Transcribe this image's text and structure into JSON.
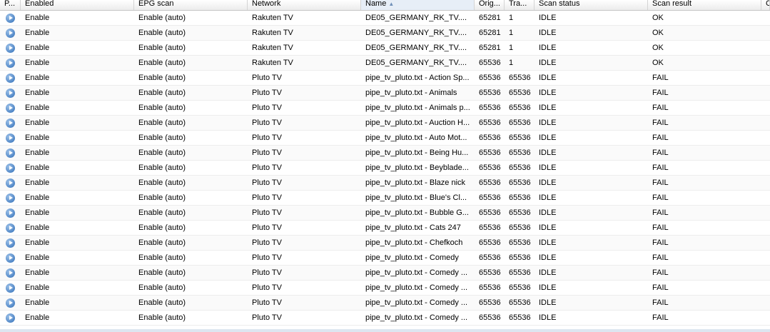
{
  "columns": [
    {
      "key": "play",
      "label": "P...",
      "width": 29
    },
    {
      "key": "enabled",
      "label": "Enabled",
      "width": 159
    },
    {
      "key": "epg",
      "label": "EPG scan",
      "width": 159
    },
    {
      "key": "network",
      "label": "Network",
      "width": 159
    },
    {
      "key": "name",
      "label": "Name",
      "width": 159,
      "sorted": "asc"
    },
    {
      "key": "orig",
      "label": "Orig...",
      "width": 42
    },
    {
      "key": "tra",
      "label": "Tra...",
      "width": 42
    },
    {
      "key": "scan_status",
      "label": "Scan status",
      "width": 159
    },
    {
      "key": "scan_result",
      "label": "Scan result",
      "width": 159
    },
    {
      "key": "extra",
      "label": "C",
      "width": 12
    }
  ],
  "rows": [
    {
      "enabled": "Enable",
      "epg": "Enable (auto)",
      "network": "Rakuten TV",
      "name": "DE05_GERMANY_RK_TV....",
      "orig": "65281",
      "tra": "1",
      "scan_status": "IDLE",
      "scan_result": "OK"
    },
    {
      "enabled": "Enable",
      "epg": "Enable (auto)",
      "network": "Rakuten TV",
      "name": "DE05_GERMANY_RK_TV....",
      "orig": "65281",
      "tra": "1",
      "scan_status": "IDLE",
      "scan_result": "OK"
    },
    {
      "enabled": "Enable",
      "epg": "Enable (auto)",
      "network": "Rakuten TV",
      "name": "DE05_GERMANY_RK_TV....",
      "orig": "65281",
      "tra": "1",
      "scan_status": "IDLE",
      "scan_result": "OK"
    },
    {
      "enabled": "Enable",
      "epg": "Enable (auto)",
      "network": "Rakuten TV",
      "name": "DE05_GERMANY_RK_TV....",
      "orig": "65536",
      "tra": "1",
      "scan_status": "IDLE",
      "scan_result": "OK"
    },
    {
      "enabled": "Enable",
      "epg": "Enable (auto)",
      "network": "Pluto TV",
      "name": "pipe_tv_pluto.txt - Action Sp...",
      "orig": "65536",
      "tra": "65536",
      "scan_status": "IDLE",
      "scan_result": "FAIL"
    },
    {
      "enabled": "Enable",
      "epg": "Enable (auto)",
      "network": "Pluto TV",
      "name": "pipe_tv_pluto.txt - Animals",
      "orig": "65536",
      "tra": "65536",
      "scan_status": "IDLE",
      "scan_result": "FAIL"
    },
    {
      "enabled": "Enable",
      "epg": "Enable (auto)",
      "network": "Pluto TV",
      "name": "pipe_tv_pluto.txt - Animals p...",
      "orig": "65536",
      "tra": "65536",
      "scan_status": "IDLE",
      "scan_result": "FAIL"
    },
    {
      "enabled": "Enable",
      "epg": "Enable (auto)",
      "network": "Pluto TV",
      "name": "pipe_tv_pluto.txt - Auction H...",
      "orig": "65536",
      "tra": "65536",
      "scan_status": "IDLE",
      "scan_result": "FAIL"
    },
    {
      "enabled": "Enable",
      "epg": "Enable (auto)",
      "network": "Pluto TV",
      "name": "pipe_tv_pluto.txt - Auto Mot...",
      "orig": "65536",
      "tra": "65536",
      "scan_status": "IDLE",
      "scan_result": "FAIL"
    },
    {
      "enabled": "Enable",
      "epg": "Enable (auto)",
      "network": "Pluto TV",
      "name": "pipe_tv_pluto.txt - Being Hu...",
      "orig": "65536",
      "tra": "65536",
      "scan_status": "IDLE",
      "scan_result": "FAIL"
    },
    {
      "enabled": "Enable",
      "epg": "Enable (auto)",
      "network": "Pluto TV",
      "name": "pipe_tv_pluto.txt - Beyblade...",
      "orig": "65536",
      "tra": "65536",
      "scan_status": "IDLE",
      "scan_result": "FAIL"
    },
    {
      "enabled": "Enable",
      "epg": "Enable (auto)",
      "network": "Pluto TV",
      "name": "pipe_tv_pluto.txt - Blaze nick",
      "orig": "65536",
      "tra": "65536",
      "scan_status": "IDLE",
      "scan_result": "FAIL"
    },
    {
      "enabled": "Enable",
      "epg": "Enable (auto)",
      "network": "Pluto TV",
      "name": "pipe_tv_pluto.txt - Blue's Cl...",
      "orig": "65536",
      "tra": "65536",
      "scan_status": "IDLE",
      "scan_result": "FAIL"
    },
    {
      "enabled": "Enable",
      "epg": "Enable (auto)",
      "network": "Pluto TV",
      "name": "pipe_tv_pluto.txt - Bubble G...",
      "orig": "65536",
      "tra": "65536",
      "scan_status": "IDLE",
      "scan_result": "FAIL"
    },
    {
      "enabled": "Enable",
      "epg": "Enable (auto)",
      "network": "Pluto TV",
      "name": "pipe_tv_pluto.txt - Cats 247",
      "orig": "65536",
      "tra": "65536",
      "scan_status": "IDLE",
      "scan_result": "FAIL"
    },
    {
      "enabled": "Enable",
      "epg": "Enable (auto)",
      "network": "Pluto TV",
      "name": "pipe_tv_pluto.txt - Chefkoch",
      "orig": "65536",
      "tra": "65536",
      "scan_status": "IDLE",
      "scan_result": "FAIL"
    },
    {
      "enabled": "Enable",
      "epg": "Enable (auto)",
      "network": "Pluto TV",
      "name": "pipe_tv_pluto.txt - Comedy",
      "orig": "65536",
      "tra": "65536",
      "scan_status": "IDLE",
      "scan_result": "FAIL"
    },
    {
      "enabled": "Enable",
      "epg": "Enable (auto)",
      "network": "Pluto TV",
      "name": "pipe_tv_pluto.txt - Comedy ...",
      "orig": "65536",
      "tra": "65536",
      "scan_status": "IDLE",
      "scan_result": "FAIL"
    },
    {
      "enabled": "Enable",
      "epg": "Enable (auto)",
      "network": "Pluto TV",
      "name": "pipe_tv_pluto.txt - Comedy ...",
      "orig": "65536",
      "tra": "65536",
      "scan_status": "IDLE",
      "scan_result": "FAIL"
    },
    {
      "enabled": "Enable",
      "epg": "Enable (auto)",
      "network": "Pluto TV",
      "name": "pipe_tv_pluto.txt - Comedy ...",
      "orig": "65536",
      "tra": "65536",
      "scan_status": "IDLE",
      "scan_result": "FAIL"
    },
    {
      "enabled": "Enable",
      "epg": "Enable (auto)",
      "network": "Pluto TV",
      "name": "pipe_tv_pluto.txt - Comedy ...",
      "orig": "65536",
      "tra": "65536",
      "scan_status": "IDLE",
      "scan_result": "FAIL"
    }
  ]
}
